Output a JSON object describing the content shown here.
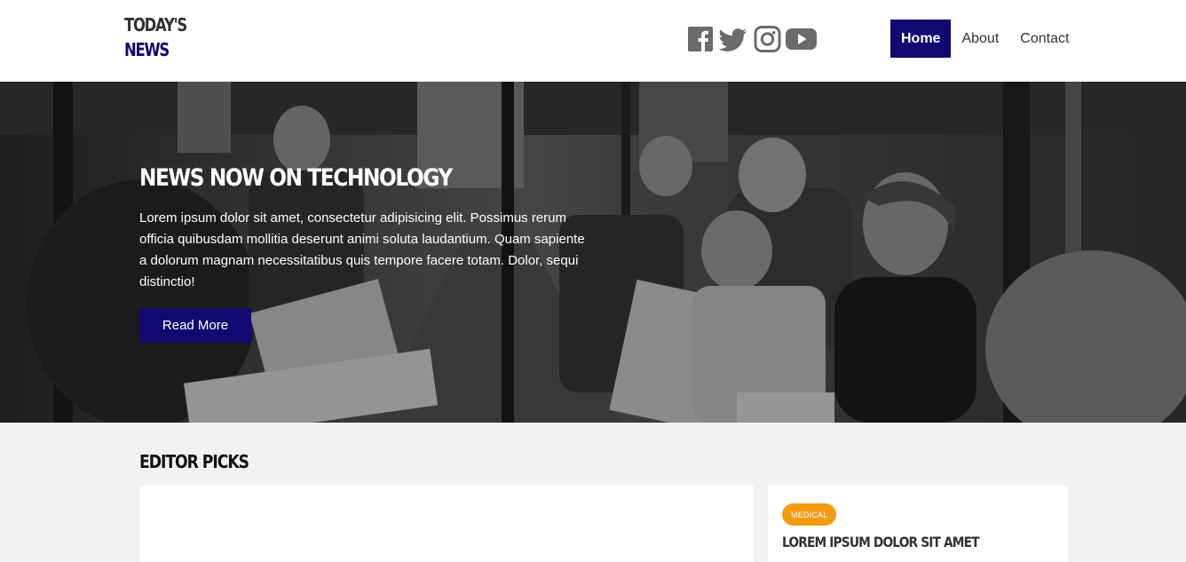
{
  "brand": {
    "line1": "TODAY'S",
    "line2": "NEWS",
    "colors": {
      "primary": "#120871",
      "text": "#333333",
      "badge": "#f39c12"
    }
  },
  "social": [
    {
      "name": "facebook-icon"
    },
    {
      "name": "twitter-icon"
    },
    {
      "name": "instagram-icon"
    },
    {
      "name": "youtube-icon"
    }
  ],
  "nav": {
    "items": [
      {
        "label": "Home",
        "active": true
      },
      {
        "label": "About",
        "active": false
      },
      {
        "label": "Contact",
        "active": false
      }
    ]
  },
  "hero": {
    "title": "NEWS NOW ON TECHNOLOGY",
    "text": "Lorem ipsum dolor sit amet, consectetur adipisicing elit. Possimus rerum officia quibusdam mollitia deserunt animi soluta laudantium. Quam sapiente a dolorum magnam necessitatibus quis tempore facere totam. Dolor, sequi distinctio!",
    "button": "Read More"
  },
  "editor_picks": {
    "title": "EDITOR PICKS",
    "side_card": {
      "category": "MEDICAL",
      "title": "LOREM IPSUM DOLOR SIT AMET"
    }
  }
}
